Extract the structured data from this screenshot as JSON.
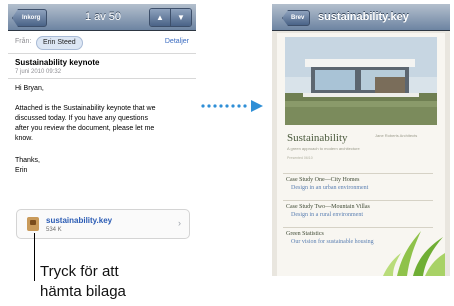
{
  "left_screen": {
    "navbar": {
      "back_label": "Inkorg",
      "title": "1 av 50",
      "up_icon": "up-arrow-icon",
      "down_icon": "down-arrow-icon"
    },
    "header": {
      "from_label": "Från:",
      "sender": "Erin Steed",
      "details_label": "Detaljer",
      "subject": "Sustainability keynote",
      "date": "7 juni 2010 09:32"
    },
    "body": {
      "greeting": "Hi Bryan,",
      "paragraph_lines": [
        "Attached is the Sustainability keynote that we",
        "discussed today. If you have any questions",
        "after you review the document, please let me",
        "know."
      ],
      "signoff": "Thanks,",
      "signature": "Erin"
    },
    "attachment": {
      "file_name": "sustainability.key",
      "file_size": "534 K",
      "icon": "keynote-file-icon"
    }
  },
  "callout": {
    "line1": "Tryck för att",
    "line2": "hämta bilaga"
  },
  "right_screen": {
    "navbar": {
      "back_label": "Brev",
      "title": "sustainability.key"
    },
    "document": {
      "heading": "Sustainability",
      "subheading": "A green approach to modern architecture",
      "author_tag": "Jane Roberts Architects",
      "meta": "Presented 06/10",
      "cases": [
        {
          "title": "Case Study One—City Homes",
          "link": "Design in an urban environment"
        },
        {
          "title": "Case Study Two—Mountain Villas",
          "link": "Design in a rural environment"
        },
        {
          "title": "Green Statistics",
          "link": "Our vision for sustainable housing"
        }
      ]
    }
  },
  "colors": {
    "navbar_top": "#b3bfcd",
    "navbar_bottom": "#6d84a2",
    "link_blue": "#3b6cc1",
    "arrow_blue": "#2f8fd6"
  }
}
